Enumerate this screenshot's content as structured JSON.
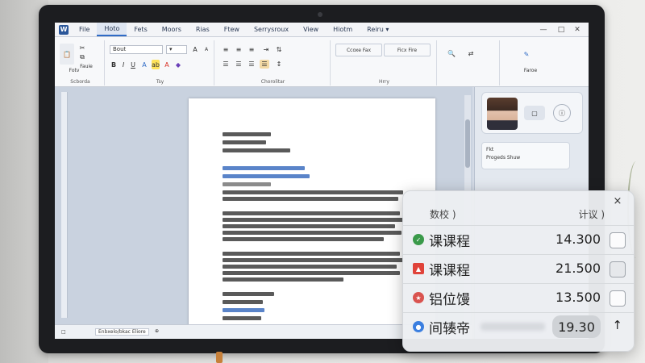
{
  "menubar": {
    "items": [
      "File",
      "Hoto",
      "Fets",
      "Moors",
      "Rias",
      "Ftew",
      "Serrysroux",
      "View",
      "Hiotm",
      "Reiru ▾"
    ]
  },
  "ribbon": {
    "font_name": "Bout",
    "font_size": "▾",
    "group_labels": [
      "Scborda",
      "Tsy",
      "Chorolitar",
      "Hrry"
    ],
    "buttons": {
      "paste": "Fotv",
      "format": "Fauie",
      "bold": "B",
      "italic": "I",
      "underline": "U",
      "styles_a": "Ccoxe Fax",
      "styles_b": "Ficx Fire",
      "edit": "Faroe"
    }
  },
  "document": {
    "status_text": "Enbxelo/bkac Eliore"
  },
  "side_pane": {
    "info_line1": "Fkt",
    "info_line2": "Progeds Shuw"
  },
  "panel": {
    "close": "×",
    "header_left": "数校 )",
    "header_right": "计议 )",
    "rows": [
      {
        "name": "课课程",
        "value": "14.300",
        "icon_color": "#3a9a4a"
      },
      {
        "name": "课课程",
        "value": "21.500",
        "icon_color": "#e0433a"
      },
      {
        "name": "铝位馒",
        "value": "13.500",
        "icon_color": "#d9534f"
      },
      {
        "name": "间辏帝",
        "value": "19.30",
        "icon_color": "#3b7fe0",
        "arrow": "↑"
      }
    ]
  },
  "colors": {
    "accent": "#2f6bc6",
    "panel_bg": "#eceef1"
  }
}
